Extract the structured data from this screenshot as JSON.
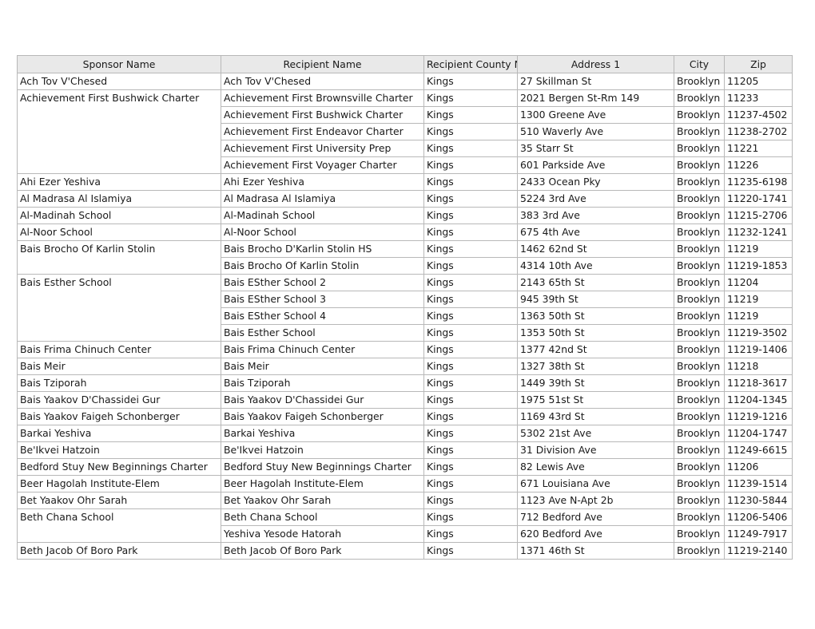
{
  "table": {
    "columns": [
      {
        "key": "sponsor_name",
        "label": "Sponsor Name"
      },
      {
        "key": "recipient_name",
        "label": "Recipient Name"
      },
      {
        "key": "county_name",
        "label": "Recipient County Name"
      },
      {
        "key": "address1",
        "label": "Address 1"
      },
      {
        "key": "city",
        "label": "City"
      },
      {
        "key": "zip",
        "label": "Zip"
      }
    ],
    "groups": [
      {
        "sponsor": "Ach Tov V'Chesed",
        "rows": [
          {
            "recipient": "Ach Tov V'Chesed",
            "county": "Kings",
            "address": "27 Skillman St",
            "city": "Brooklyn",
            "zip": "11205"
          }
        ]
      },
      {
        "sponsor": "Achievement First Bushwick Charter",
        "rows": [
          {
            "recipient": "Achievement First Brownsville Charter",
            "county": "Kings",
            "address": "2021 Bergen St-Rm 149",
            "city": "Brooklyn",
            "zip": "11233"
          },
          {
            "recipient": "Achievement First Bushwick Charter",
            "county": "Kings",
            "address": "1300 Greene Ave",
            "city": "Brooklyn",
            "zip": "11237-4502"
          },
          {
            "recipient": "Achievement First Endeavor Charter",
            "county": "Kings",
            "address": "510 Waverly Ave",
            "city": "Brooklyn",
            "zip": "11238-2702"
          },
          {
            "recipient": "Achievement First University Prep",
            "county": "Kings",
            "address": "35 Starr St",
            "city": "Brooklyn",
            "zip": "11221"
          },
          {
            "recipient": "Achievement First Voyager Charter",
            "county": "Kings",
            "address": "601 Parkside Ave",
            "city": "Brooklyn",
            "zip": "11226"
          }
        ]
      },
      {
        "sponsor": "Ahi Ezer Yeshiva",
        "rows": [
          {
            "recipient": "Ahi Ezer Yeshiva",
            "county": "Kings",
            "address": "2433 Ocean Pky",
            "city": "Brooklyn",
            "zip": "11235-6198"
          }
        ]
      },
      {
        "sponsor": "Al Madrasa Al Islamiya",
        "rows": [
          {
            "recipient": "Al Madrasa Al Islamiya",
            "county": "Kings",
            "address": "5224 3rd Ave",
            "city": "Brooklyn",
            "zip": "11220-1741"
          }
        ]
      },
      {
        "sponsor": "Al-Madinah School",
        "rows": [
          {
            "recipient": "Al-Madinah School",
            "county": "Kings",
            "address": "383 3rd Ave",
            "city": "Brooklyn",
            "zip": "11215-2706"
          }
        ]
      },
      {
        "sponsor": "Al-Noor School",
        "rows": [
          {
            "recipient": "Al-Noor School",
            "county": "Kings",
            "address": "675 4th Ave",
            "city": "Brooklyn",
            "zip": "11232-1241"
          }
        ]
      },
      {
        "sponsor": "Bais Brocho Of Karlin Stolin",
        "rows": [
          {
            "recipient": "Bais Brocho D'Karlin Stolin HS",
            "county": "Kings",
            "address": "1462 62nd St",
            "city": "Brooklyn",
            "zip": "11219"
          },
          {
            "recipient": "Bais Brocho Of Karlin Stolin",
            "county": "Kings",
            "address": "4314 10th Ave",
            "city": "Brooklyn",
            "zip": "11219-1853"
          }
        ]
      },
      {
        "sponsor": "Bais Esther School",
        "rows": [
          {
            "recipient": "Bais ESther School 2",
            "county": "Kings",
            "address": "2143 65th St",
            "city": "Brooklyn",
            "zip": "11204"
          },
          {
            "recipient": "Bais ESther School 3",
            "county": "Kings",
            "address": "945 39th St",
            "city": "Brooklyn",
            "zip": "11219"
          },
          {
            "recipient": "Bais ESther School 4",
            "county": "Kings",
            "address": "1363 50th St",
            "city": "Brooklyn",
            "zip": "11219"
          },
          {
            "recipient": "Bais Esther School",
            "county": "Kings",
            "address": "1353 50th St",
            "city": "Brooklyn",
            "zip": "11219-3502"
          }
        ]
      },
      {
        "sponsor": "Bais Frima Chinuch Center",
        "rows": [
          {
            "recipient": "Bais Frima Chinuch Center",
            "county": "Kings",
            "address": "1377 42nd St",
            "city": "Brooklyn",
            "zip": "11219-1406"
          }
        ]
      },
      {
        "sponsor": "Bais Meir",
        "rows": [
          {
            "recipient": "Bais Meir",
            "county": "Kings",
            "address": "1327 38th St",
            "city": "Brooklyn",
            "zip": "11218"
          }
        ]
      },
      {
        "sponsor": "Bais Tziporah",
        "rows": [
          {
            "recipient": "Bais Tziporah",
            "county": "Kings",
            "address": "1449 39th St",
            "city": "Brooklyn",
            "zip": "11218-3617"
          }
        ]
      },
      {
        "sponsor": "Bais Yaakov D'Chassidei Gur",
        "rows": [
          {
            "recipient": "Bais Yaakov D'Chassidei Gur",
            "county": "Kings",
            "address": "1975 51st St",
            "city": "Brooklyn",
            "zip": "11204-1345"
          }
        ]
      },
      {
        "sponsor": "Bais Yaakov Faigeh Schonberger",
        "rows": [
          {
            "recipient": "Bais Yaakov Faigeh Schonberger",
            "county": "Kings",
            "address": "1169 43rd St",
            "city": "Brooklyn",
            "zip": "11219-1216"
          }
        ]
      },
      {
        "sponsor": "Barkai Yeshiva",
        "rows": [
          {
            "recipient": "Barkai Yeshiva",
            "county": "Kings",
            "address": "5302 21st Ave",
            "city": "Brooklyn",
            "zip": "11204-1747"
          }
        ]
      },
      {
        "sponsor": "Be'Ikvei Hatzoin",
        "rows": [
          {
            "recipient": "Be'Ikvei Hatzoin",
            "county": "Kings",
            "address": "31 Division Ave",
            "city": "Brooklyn",
            "zip": "11249-6615"
          }
        ]
      },
      {
        "sponsor": "Bedford Stuy New Beginnings Charter",
        "rows": [
          {
            "recipient": "Bedford Stuy New Beginnings Charter",
            "county": "Kings",
            "address": "82 Lewis Ave",
            "city": "Brooklyn",
            "zip": "11206"
          }
        ]
      },
      {
        "sponsor": "Beer Hagolah Institute-Elem",
        "rows": [
          {
            "recipient": "Beer Hagolah Institute-Elem",
            "county": "Kings",
            "address": "671 Louisiana Ave",
            "city": "Brooklyn",
            "zip": "11239-1514"
          }
        ]
      },
      {
        "sponsor": "Bet Yaakov Ohr Sarah",
        "rows": [
          {
            "recipient": "Bet Yaakov Ohr Sarah",
            "county": "Kings",
            "address": "1123 Ave N-Apt 2b",
            "city": "Brooklyn",
            "zip": "11230-5844"
          }
        ]
      },
      {
        "sponsor": "Beth Chana School",
        "rows": [
          {
            "recipient": "Beth Chana School",
            "county": "Kings",
            "address": "712 Bedford Ave",
            "city": "Brooklyn",
            "zip": "11206-5406"
          },
          {
            "recipient": "Yeshiva Yesode Hatorah",
            "county": "Kings",
            "address": "620 Bedford Ave",
            "city": "Brooklyn",
            "zip": "11249-7917"
          }
        ]
      },
      {
        "sponsor": "Beth Jacob Of Boro Park",
        "rows": [
          {
            "recipient": "Beth Jacob Of Boro Park",
            "county": "Kings",
            "address": "1371 46th St",
            "city": "Brooklyn",
            "zip": "11219-2140"
          }
        ]
      }
    ]
  },
  "colors": {
    "header_background": "#e9e9e9",
    "grid_line": "#b8b8b8",
    "cell_background": "#ffffff",
    "text": "#1a1a1a"
  }
}
